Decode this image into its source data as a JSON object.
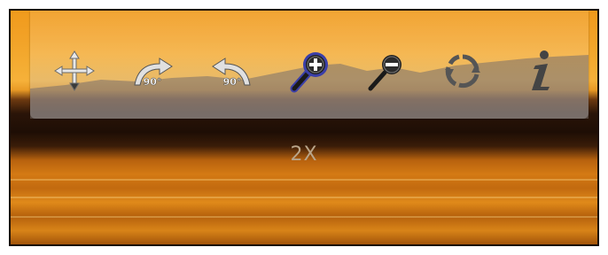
{
  "toolbar": {
    "tools": [
      {
        "name": "pan",
        "icon": "move-arrows-icon"
      },
      {
        "name": "rotate-left",
        "icon": "rotate-left-icon",
        "label": "90°"
      },
      {
        "name": "rotate-right",
        "icon": "rotate-right-icon",
        "label": "90°"
      },
      {
        "name": "zoom-in",
        "icon": "zoom-in-icon",
        "active": true
      },
      {
        "name": "zoom-out",
        "icon": "zoom-out-icon"
      },
      {
        "name": "reset",
        "icon": "refresh-icon"
      },
      {
        "name": "info",
        "icon": "info-icon"
      }
    ]
  },
  "status": {
    "zoom_level": "2X"
  },
  "colors": {
    "sky": "#f4ad33",
    "water": "#d47a14",
    "active_glow": "#3b3fa8"
  }
}
